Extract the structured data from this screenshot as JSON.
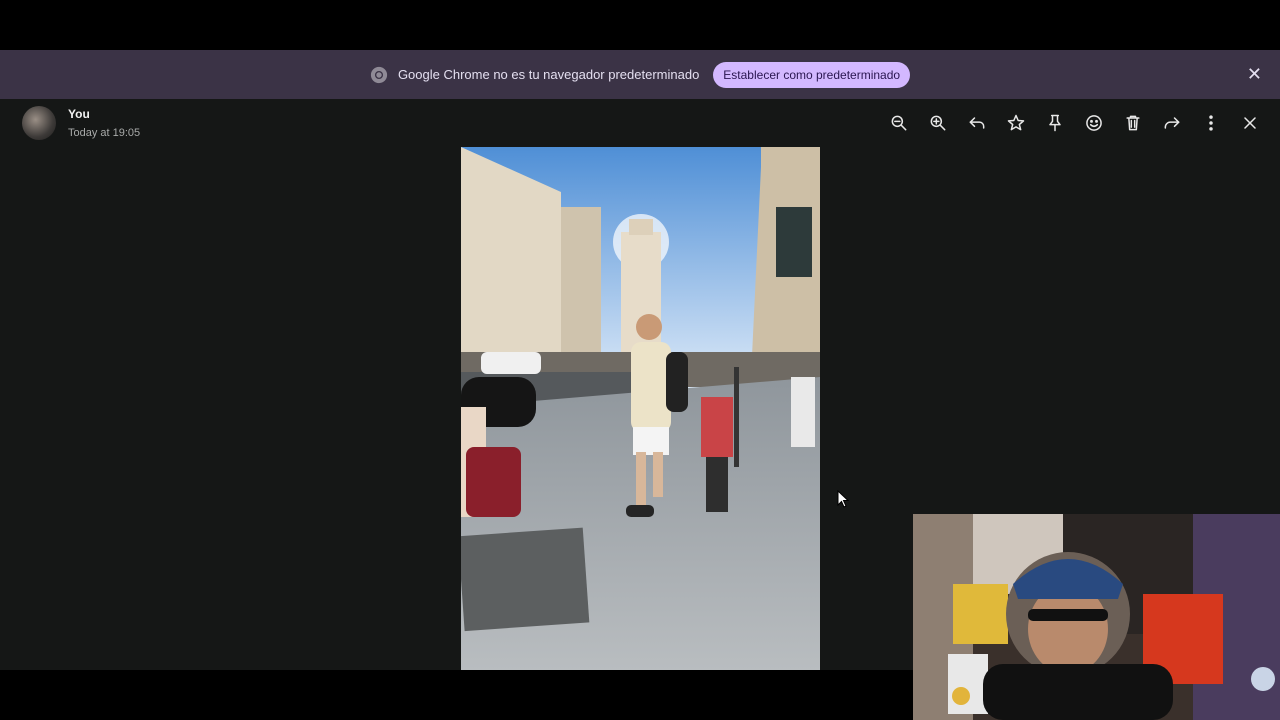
{
  "infobar": {
    "message": "Google Chrome no es tu navegador predeterminado",
    "button_label": "Establecer como predeterminado",
    "close_glyph": "✕"
  },
  "user": {
    "name": "You",
    "time": "Today at 19:05"
  },
  "toolbar": {
    "icons": [
      "zoom-out-icon",
      "zoom-in-icon",
      "reply-icon",
      "star-icon",
      "pin-icon",
      "emoji-icon",
      "delete-icon",
      "forward-icon",
      "more-icon",
      "close-icon"
    ]
  },
  "colors": {
    "infobar_bg": "#3b3346",
    "button_bg": "#d3b8ff",
    "viewer_bg": "#151716"
  }
}
